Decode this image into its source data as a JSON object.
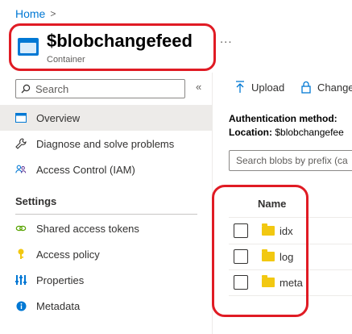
{
  "breadcrumb": {
    "home": "Home",
    "separator": ">"
  },
  "header": {
    "title": "$blobchangefeed",
    "subtitle": "Container",
    "more": "...",
    "icon": "storage-container-icon"
  },
  "sidebar": {
    "search_placeholder": "Search",
    "collapse": "«",
    "items": [
      {
        "label": "Overview",
        "icon": "overview-icon",
        "selected": true
      },
      {
        "label": "Diagnose and solve problems",
        "icon": "wrench-icon"
      },
      {
        "label": "Access Control (IAM)",
        "icon": "people-icon"
      }
    ],
    "settings_heading": "Settings",
    "settings_items": [
      {
        "label": "Shared access tokens",
        "icon": "link-icon"
      },
      {
        "label": "Access policy",
        "icon": "key-icon"
      },
      {
        "label": "Properties",
        "icon": "properties-icon"
      },
      {
        "label": "Metadata",
        "icon": "info-icon"
      }
    ]
  },
  "toolbar": {
    "upload": "Upload",
    "change": "Change"
  },
  "info": {
    "auth_label": "Authentication method:",
    "location_label": "Location:",
    "location_value": "$blobchangefee"
  },
  "blob_search": {
    "placeholder": "Search blobs by prefix (ca"
  },
  "table": {
    "column_name": "Name",
    "rows": [
      {
        "name": "idx"
      },
      {
        "name": "log"
      },
      {
        "name": "meta"
      }
    ]
  },
  "colors": {
    "accent": "#0078d4",
    "highlight_ring": "#e01b24",
    "folder": "#f2c811",
    "selected_bg": "#edebe9"
  }
}
